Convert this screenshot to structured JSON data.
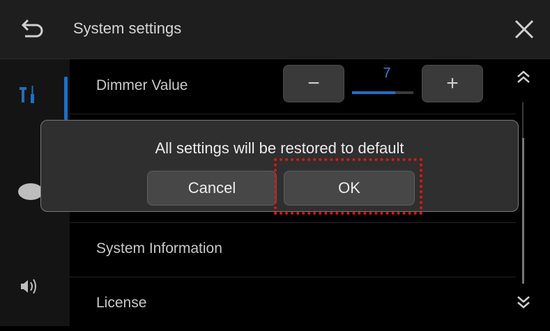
{
  "header": {
    "title": "System settings",
    "back_icon": "back-arrow-icon",
    "close_icon": "close-icon"
  },
  "sidebar": {
    "items": [
      {
        "icon": "tools-icon",
        "active": true
      },
      {
        "icon": "palette-icon",
        "active": false
      },
      {
        "icon": "speaker-icon",
        "active": false
      }
    ],
    "accent_color": "#1f6fc5"
  },
  "list": {
    "dimmer": {
      "label": "Dimmer Value",
      "value": "7",
      "level": 0.7,
      "minus": "−",
      "plus": "+"
    },
    "system_information": {
      "label": "System Information"
    },
    "license": {
      "label": "License"
    }
  },
  "dialog": {
    "message": "All settings will be restored to default",
    "cancel_label": "Cancel",
    "ok_label": "OK"
  },
  "highlight_color": "#e8130f"
}
